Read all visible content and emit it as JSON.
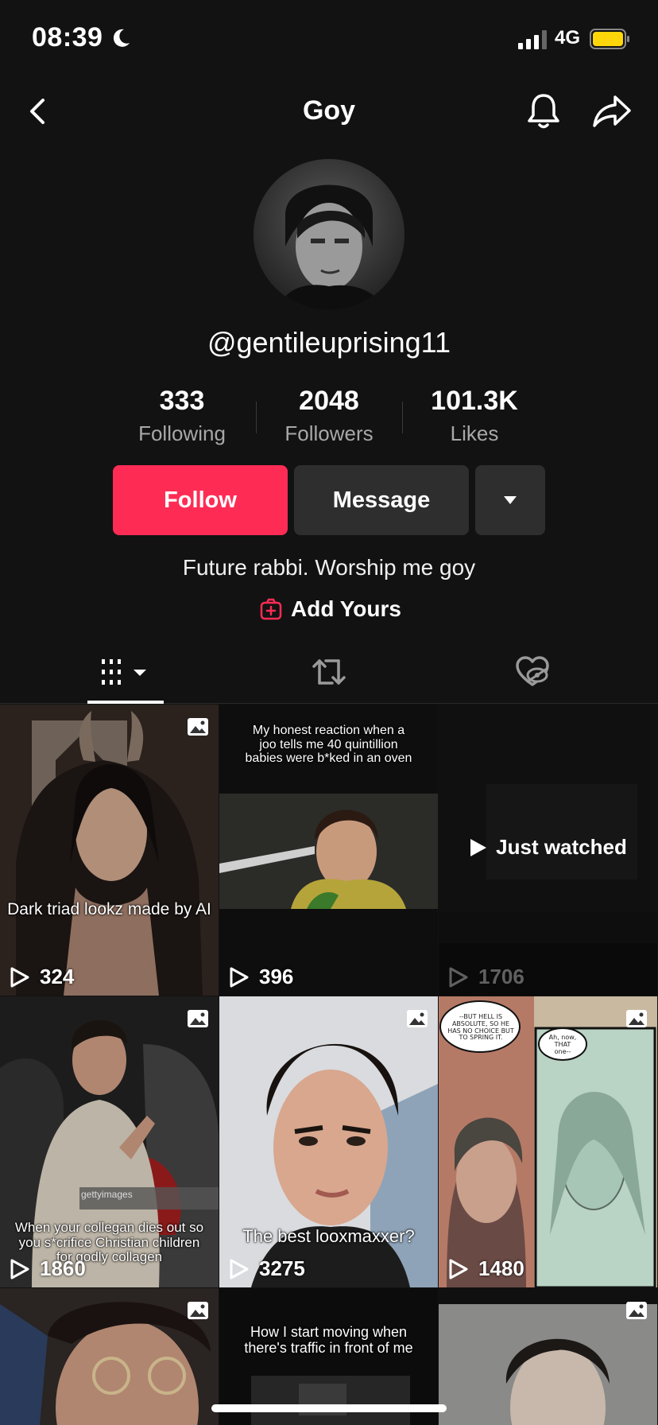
{
  "status_bar": {
    "time": "08:39",
    "network": "4G"
  },
  "header": {
    "title": "Goy"
  },
  "profile": {
    "username": "@gentileuprising11",
    "bio": "Future rabbi. Worship me goy",
    "add_yours": "Add Yours"
  },
  "stats": {
    "following": {
      "value": "333",
      "label": "Following"
    },
    "followers": {
      "value": "2048",
      "label": "Followers"
    },
    "likes": {
      "value": "101.3K",
      "label": "Likes"
    }
  },
  "actions": {
    "follow": "Follow",
    "message": "Message"
  },
  "colors": {
    "accent": "#fe2c55",
    "background": "#121212",
    "battery": "#ffd60a"
  },
  "tabs": [
    {
      "icon": "grid-icon",
      "active": true
    },
    {
      "icon": "repost-icon",
      "active": false
    },
    {
      "icon": "liked-hidden-icon",
      "active": false
    }
  ],
  "videos": [
    {
      "caption": "Dark triad lookz made by AI",
      "views": "324",
      "photo": true
    },
    {
      "caption": "My honest reaction when a joo tells me 40 quintillion babies were b*ked in an oven",
      "views": "396",
      "photo": false
    },
    {
      "overlay": "Just watched",
      "views": "1706",
      "photo": false
    },
    {
      "caption": "When your collegan dies out so you s*crifice Christian children for godly collagen",
      "views": "1860",
      "photo": true,
      "watermark": "gettyimages"
    },
    {
      "caption": "The best looxmaxxer?",
      "views": "3275",
      "photo": true
    },
    {
      "views": "1480",
      "photo": true,
      "comic_text_1": "--BUT HELL IS ABSOLUTE, SO HE HAS NO CHOICE BUT TO SPRING IT.",
      "comic_text_2": "Ah, now, THAT one--"
    },
    {
      "photo": true
    },
    {
      "caption": "How I start moving when there's traffic in front of me",
      "photo": false
    },
    {
      "photo": true
    }
  ]
}
